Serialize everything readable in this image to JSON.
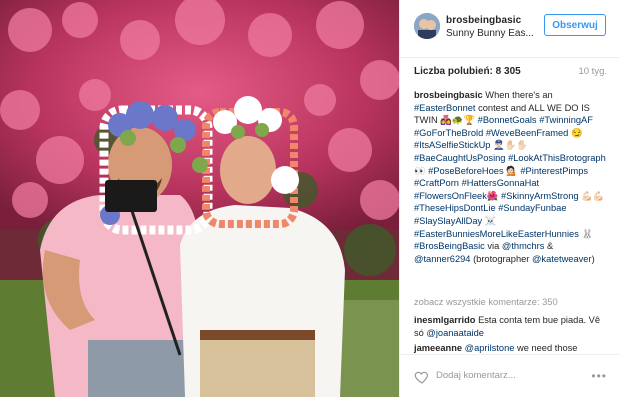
{
  "post": {
    "username": "brosbeingbasic",
    "location": "Sunny Bunny Eas...",
    "follow_label": "Obserwuj",
    "likes_label": "Liczba polubień: 8 305",
    "timestamp": "10 tyg."
  },
  "caption": {
    "user": "brosbeingbasic",
    "segments": [
      {
        "t": "text",
        "v": " When there's an "
      },
      {
        "t": "tag",
        "v": "#EasterBonnet"
      },
      {
        "t": "text",
        "v": " contest and ALL WE DO IS TWIN 👩‍❤️‍👩🐢🏆 "
      },
      {
        "t": "tag",
        "v": "#BonnetGoals"
      },
      {
        "t": "text",
        "v": " "
      },
      {
        "t": "tag",
        "v": "#TwinningAF"
      },
      {
        "t": "text",
        "v": " "
      },
      {
        "t": "tag",
        "v": "#GoForTheBrold"
      },
      {
        "t": "text",
        "v": " "
      },
      {
        "t": "tag",
        "v": "#WeveBeenFramed"
      },
      {
        "t": "text",
        "v": " 😏 "
      },
      {
        "t": "tag",
        "v": "#ItsASelfieStickUp"
      },
      {
        "t": "text",
        "v": " 👮🏻‍♂️✋🏻✋🏻 "
      },
      {
        "t": "tag",
        "v": "#BaeCaughtUsPosing"
      },
      {
        "t": "text",
        "v": " "
      },
      {
        "t": "tag",
        "v": "#LookAtThisBrotograph"
      },
      {
        "t": "text",
        "v": "👀 "
      },
      {
        "t": "tag",
        "v": "#PoseBeforeHoes"
      },
      {
        "t": "text",
        "v": " 💁🏻 "
      },
      {
        "t": "tag",
        "v": "#PinterestPimps"
      },
      {
        "t": "text",
        "v": " "
      },
      {
        "t": "tag",
        "v": "#CraftPorn"
      },
      {
        "t": "text",
        "v": " "
      },
      {
        "t": "tag",
        "v": "#HattersGonnaHat"
      },
      {
        "t": "text",
        "v": " "
      },
      {
        "t": "tag",
        "v": "#FlowersOnFleek"
      },
      {
        "t": "text",
        "v": "🌺 "
      },
      {
        "t": "tag",
        "v": "#SkinnyArmStrong"
      },
      {
        "t": "text",
        "v": " 💪🏻💪🏻 "
      },
      {
        "t": "tag",
        "v": "#TheseHipsDontLie"
      },
      {
        "t": "text",
        "v": " "
      },
      {
        "t": "tag",
        "v": "#SundayFunbae"
      },
      {
        "t": "text",
        "v": " "
      },
      {
        "t": "tag",
        "v": "#SlaySlayAllDay"
      },
      {
        "t": "text",
        "v": " ☠️ "
      },
      {
        "t": "tag",
        "v": "#EasterBunniesMoreLikeEasterHunnies"
      },
      {
        "t": "text",
        "v": " 🐰 "
      },
      {
        "t": "tag",
        "v": "#BrosBeingBasic"
      },
      {
        "t": "text",
        "v": " via "
      },
      {
        "t": "tag",
        "v": "@thmchrs"
      },
      {
        "t": "text",
        "v": " & "
      },
      {
        "t": "tag",
        "v": "@tanner6294"
      },
      {
        "t": "text",
        "v": " (brotographer "
      },
      {
        "t": "tag",
        "v": "@katetweaver"
      },
      {
        "t": "text",
        "v": ")"
      }
    ]
  },
  "view_all_comments": "zobacz wszystkie komentarze: 350",
  "comments": [
    {
      "user": "inesmlgarrido",
      "segments": [
        {
          "t": "text",
          "v": " Esta conta tem bue piada. Vê só "
        },
        {
          "t": "tag",
          "v": "@joanaataide"
        }
      ]
    },
    {
      "user": "jameeanne",
      "segments": [
        {
          "t": "text",
          "v": " "
        },
        {
          "t": "tag",
          "v": "@aprilstone"
        },
        {
          "t": "text",
          "v": " we need those"
        }
      ]
    }
  ],
  "footer": {
    "comment_placeholder": "Dodaj komentarz...",
    "more_icon": "•••"
  },
  "colors": {
    "accent": "#3897f0",
    "tag": "#003569",
    "muted": "#999999"
  }
}
